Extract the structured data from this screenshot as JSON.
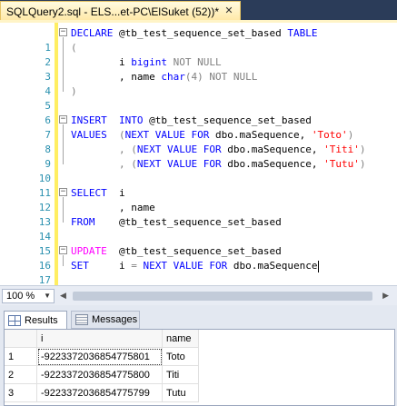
{
  "tab": {
    "title": "SQLQuery2.sql - ELS...et-PC\\ElSuket (52))*"
  },
  "editor": {
    "line_numbers": [
      "1",
      "2",
      "3",
      "4",
      "5",
      "6",
      "7",
      "8",
      "9",
      "10",
      "11",
      "12",
      "13",
      "14",
      "15",
      "16",
      "17"
    ],
    "l1": {
      "kw1": "DECLARE",
      "var": " @tb_test_sequence_set_based ",
      "kw2": "TABLE"
    },
    "l2": {
      "p": "("
    },
    "l3": {
      "txt": "        i ",
      "kw": "bigint",
      "gr": " NOT NULL"
    },
    "l4": {
      "txt": "        , name ",
      "kw": "char",
      "p": "(4)",
      "gr": " NOT NULL"
    },
    "l5": {
      "p": ")"
    },
    "l7": {
      "kw1": "INSERT",
      "pad": "  ",
      "kw2": "INTO",
      "txt": " @tb_test_sequence_set_based"
    },
    "l8": {
      "kw1": "VALUES",
      "p1": "  (",
      "kw2": "NEXT VALUE FOR",
      "txt": " dbo.maSequence, ",
      "str": "'Toto'",
      "p2": ")"
    },
    "l9": {
      "p1": "        , (",
      "kw2": "NEXT VALUE FOR",
      "txt": " dbo.maSequence, ",
      "str": "'Titi'",
      "p2": ")"
    },
    "l10": {
      "p1": "        , (",
      "kw2": "NEXT VALUE FOR",
      "txt": " dbo.maSequence, ",
      "str": "'Tutu'",
      "p2": ")"
    },
    "l12": {
      "kw1": "SELECT",
      "txt": "  i"
    },
    "l13": {
      "txt": "        , name"
    },
    "l14": {
      "kw1": "FROM",
      "txt": "    @tb_test_sequence_set_based"
    },
    "l16": {
      "kw1": "UPDATE",
      "txt": "  @tb_test_sequence_set_based"
    },
    "l17": {
      "kw1": "SET",
      "txt1": "     i ",
      "op": "=",
      "txt2": " ",
      "kw2": "NEXT VALUE FOR",
      "txt3": " dbo.maSequence"
    }
  },
  "zoom": {
    "value": "100 %"
  },
  "results": {
    "tabs": {
      "results": "Results",
      "messages": "Messages"
    },
    "columns": [
      "",
      "i",
      "name"
    ],
    "rows": [
      [
        "1",
        "-9223372036854775801",
        "Toto"
      ],
      [
        "2",
        "-9223372036854775800",
        "Titi"
      ],
      [
        "3",
        "-9223372036854775799",
        "Tutu"
      ]
    ]
  },
  "colors": {
    "keyword": "#0000ff",
    "string": "#ff0000",
    "operator_gray": "#808080",
    "update_keyword": "#ff00ff",
    "line_number": "#2b91af"
  },
  "icons": [
    "close-icon",
    "grid-icon",
    "messages-icon",
    "dropdown-arrow-icon"
  ]
}
